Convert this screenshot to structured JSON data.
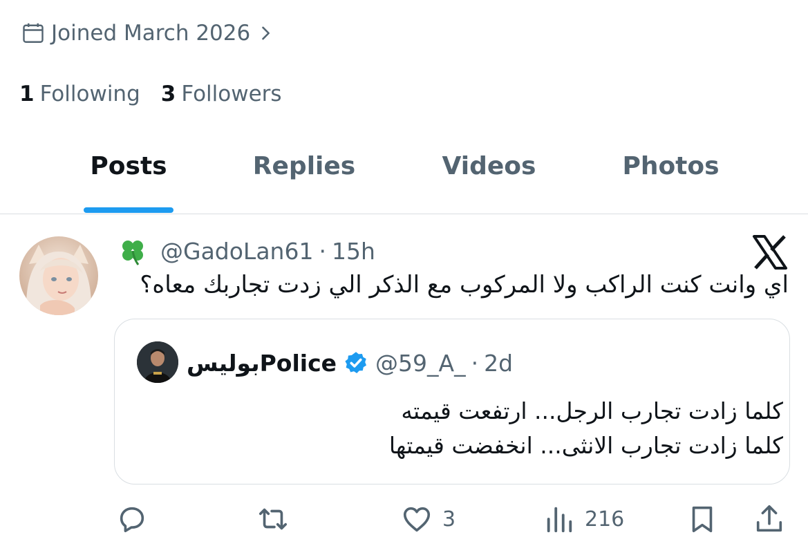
{
  "profile": {
    "joined": "Joined March 2026",
    "following_count": "1",
    "following_label": "Following",
    "followers_count": "3",
    "followers_label": "Followers"
  },
  "tabs": [
    {
      "label": "Posts",
      "active": true
    },
    {
      "label": "Replies",
      "active": false
    },
    {
      "label": "Videos",
      "active": false
    },
    {
      "label": "Photos",
      "active": false
    }
  ],
  "post": {
    "display_emoji": "🍀",
    "handle": "@GadoLan61",
    "separator": "·",
    "time": "15h",
    "text": "اي وانت كنت الراكب ولا المركوب مع الذكر الي زدت تجاربك معاه؟",
    "icons": {
      "platform": "x-logo-icon",
      "avatar": "avatar-image"
    }
  },
  "quoted": {
    "name": "بوليسPolice",
    "handle": "@59_A_",
    "separator": "·",
    "time": "2d",
    "verified": true,
    "lines": [
      "كلما زادت تجارب الرجل... ارتفعت قيمته",
      "كلما زادت تجارب الانثى... انخفضت قيمتها"
    ]
  },
  "actions": {
    "reply": {
      "icon": "reply-icon",
      "count": ""
    },
    "repost": {
      "icon": "repost-icon",
      "count": ""
    },
    "like": {
      "icon": "heart-icon",
      "count": "3"
    },
    "views": {
      "icon": "views-icon",
      "count": "216"
    },
    "bookmark": {
      "icon": "bookmark-icon"
    },
    "share": {
      "icon": "share-icon"
    }
  },
  "colors": {
    "accent": "#1d9bf0",
    "secondary_text": "#536471",
    "primary_text": "#0f1419",
    "border": "#d9dee2"
  }
}
